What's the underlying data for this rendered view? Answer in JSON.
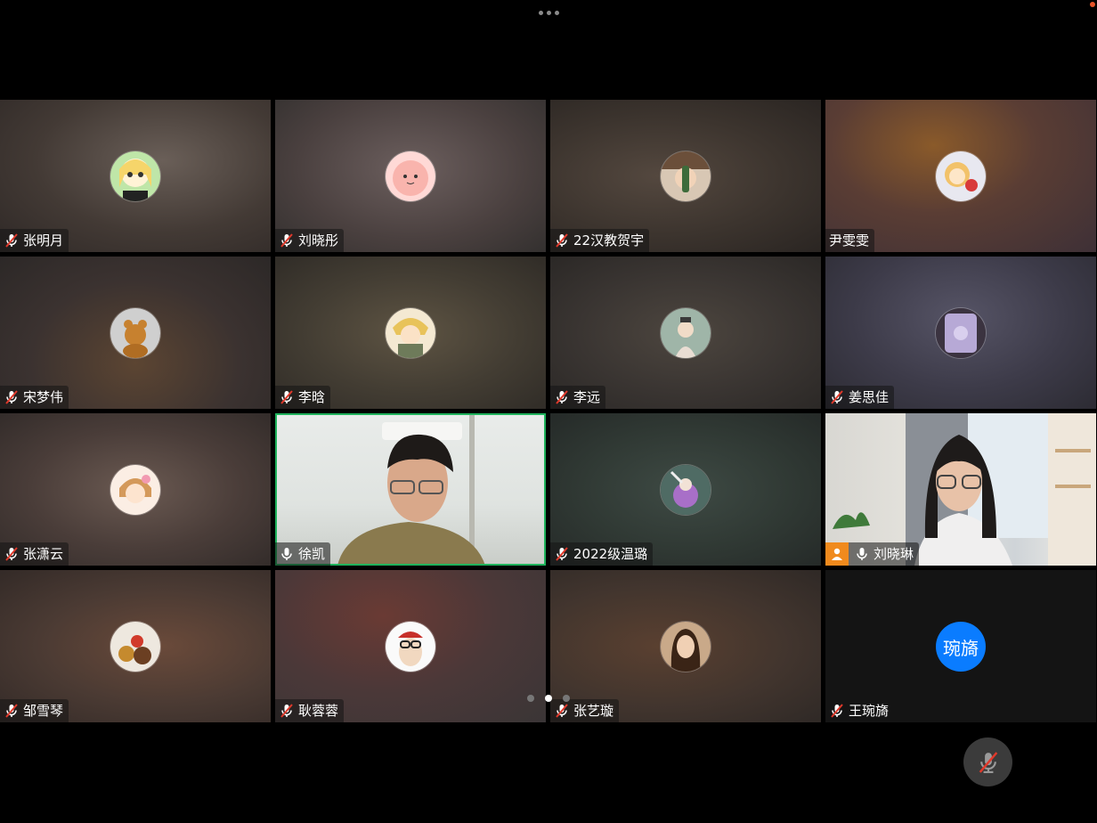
{
  "top_bar": {
    "more_icon": "more-horizontal-icon"
  },
  "participants": [
    {
      "name": "张明月",
      "mic": "muted"
    },
    {
      "name": "刘晓彤",
      "mic": "muted"
    },
    {
      "name": "22汉教贺宇",
      "mic": "muted"
    },
    {
      "name": "尹雯雯",
      "mic": "none"
    },
    {
      "name": "宋梦伟",
      "mic": "muted"
    },
    {
      "name": "李晗",
      "mic": "muted"
    },
    {
      "name": "李远",
      "mic": "muted"
    },
    {
      "name": "姜思佳",
      "mic": "muted"
    },
    {
      "name": "张潇云",
      "mic": "muted"
    },
    {
      "name": "徐凯",
      "mic": "on"
    },
    {
      "name": "2022级温璐",
      "mic": "muted"
    },
    {
      "name": "刘晓琳",
      "mic": "on"
    },
    {
      "name": "邹雪琴",
      "mic": "muted"
    },
    {
      "name": "耿蓉蓉",
      "mic": "muted"
    },
    {
      "name": "张艺璇",
      "mic": "muted"
    },
    {
      "name": "王琬旖",
      "mic": "muted",
      "avatar_text": "琬旖"
    }
  ],
  "pager": {
    "pages": 3,
    "current": 2
  },
  "colors": {
    "active_speaker_border": "#1fb35c",
    "text_avatar_bg": "#0a7cff",
    "host_badge": "#f08a1d",
    "muted_mic": "#e0392b"
  }
}
